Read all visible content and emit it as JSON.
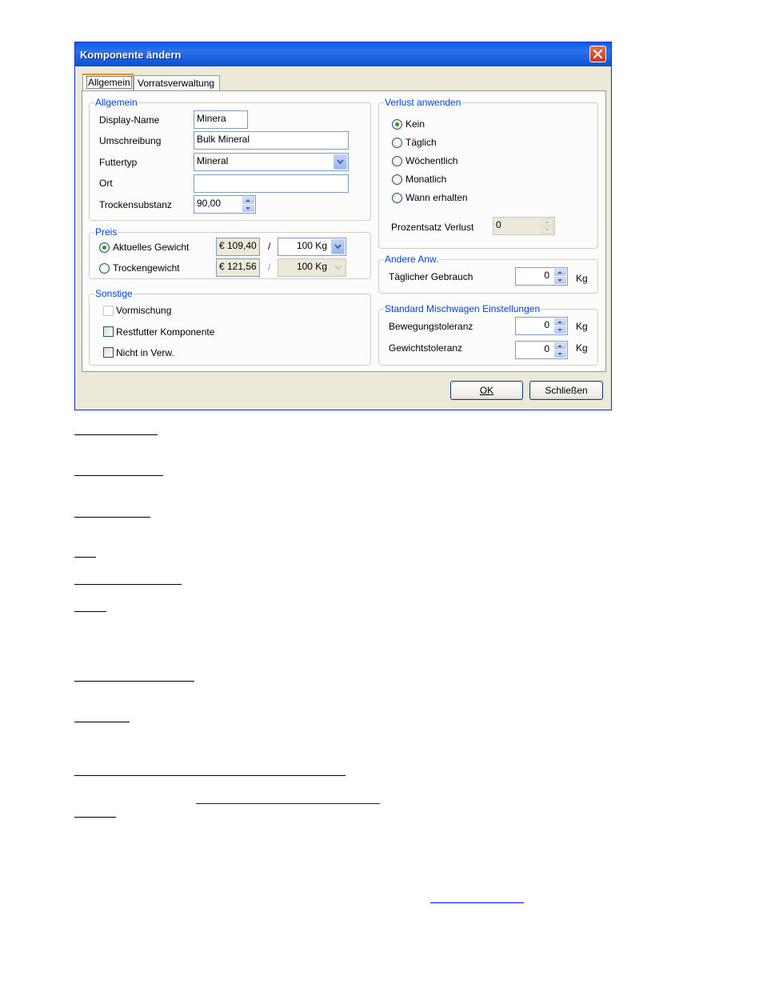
{
  "window": {
    "title": "Komponente ändern"
  },
  "tabs": [
    {
      "label": "Allgemein",
      "active": true
    },
    {
      "label": "Vorratsverwaltung",
      "active": false
    }
  ],
  "general": {
    "title": "Allgemein",
    "display_name": {
      "label": "Display-Name",
      "value": "Minera"
    },
    "description": {
      "label": "Umschreibung",
      "value": "Bulk Mineral"
    },
    "feed_type": {
      "label": "Futtertyp",
      "value": "Mineral"
    },
    "location": {
      "label": "Ort",
      "value": ""
    },
    "dry_matter": {
      "label": "Trockensubstanz",
      "value": "90,00"
    }
  },
  "price": {
    "title": "Preis",
    "current_weight": {
      "label": "Aktuelles Gewicht",
      "price": "€ 109,40",
      "unit": "100 Kg",
      "selected": true
    },
    "dry_weight": {
      "label": "Trockengewicht",
      "price": "€ 121,56",
      "unit": "100 Kg",
      "selected": false
    },
    "separator": "/"
  },
  "other": {
    "title": "Sonstige",
    "premix": "Vormischung",
    "rest_feed": "Restfutter Komponente",
    "not_in_use": "Nicht in Verw."
  },
  "loss": {
    "title": "Verlust anwenden",
    "options": [
      "Kein",
      "Täglich",
      "Wöchentlich",
      "Monatlich",
      "Wann erhalten"
    ],
    "selected_index": 0,
    "percent_label": "Prozentsatz Verlust",
    "percent_value": "0"
  },
  "other_use": {
    "title": "Andere Anw.",
    "daily_label": "Täglicher Gebrauch",
    "daily_value": "0",
    "unit": "Kg"
  },
  "mixer": {
    "title": "Standard Mischwagen Einstellungen",
    "movement_label": "Bewegungstoleranz",
    "movement_value": "0",
    "weight_label": "Gewichtstoleranz",
    "weight_value": "0",
    "unit": "Kg"
  },
  "buttons": {
    "ok": "OK",
    "close": "Schließen"
  },
  "colors": {
    "title_bar": "#0A5FE8",
    "group_title": "#0046D5",
    "dialog_bg": "#ECE9D8",
    "radio_dot": "#21A121"
  }
}
